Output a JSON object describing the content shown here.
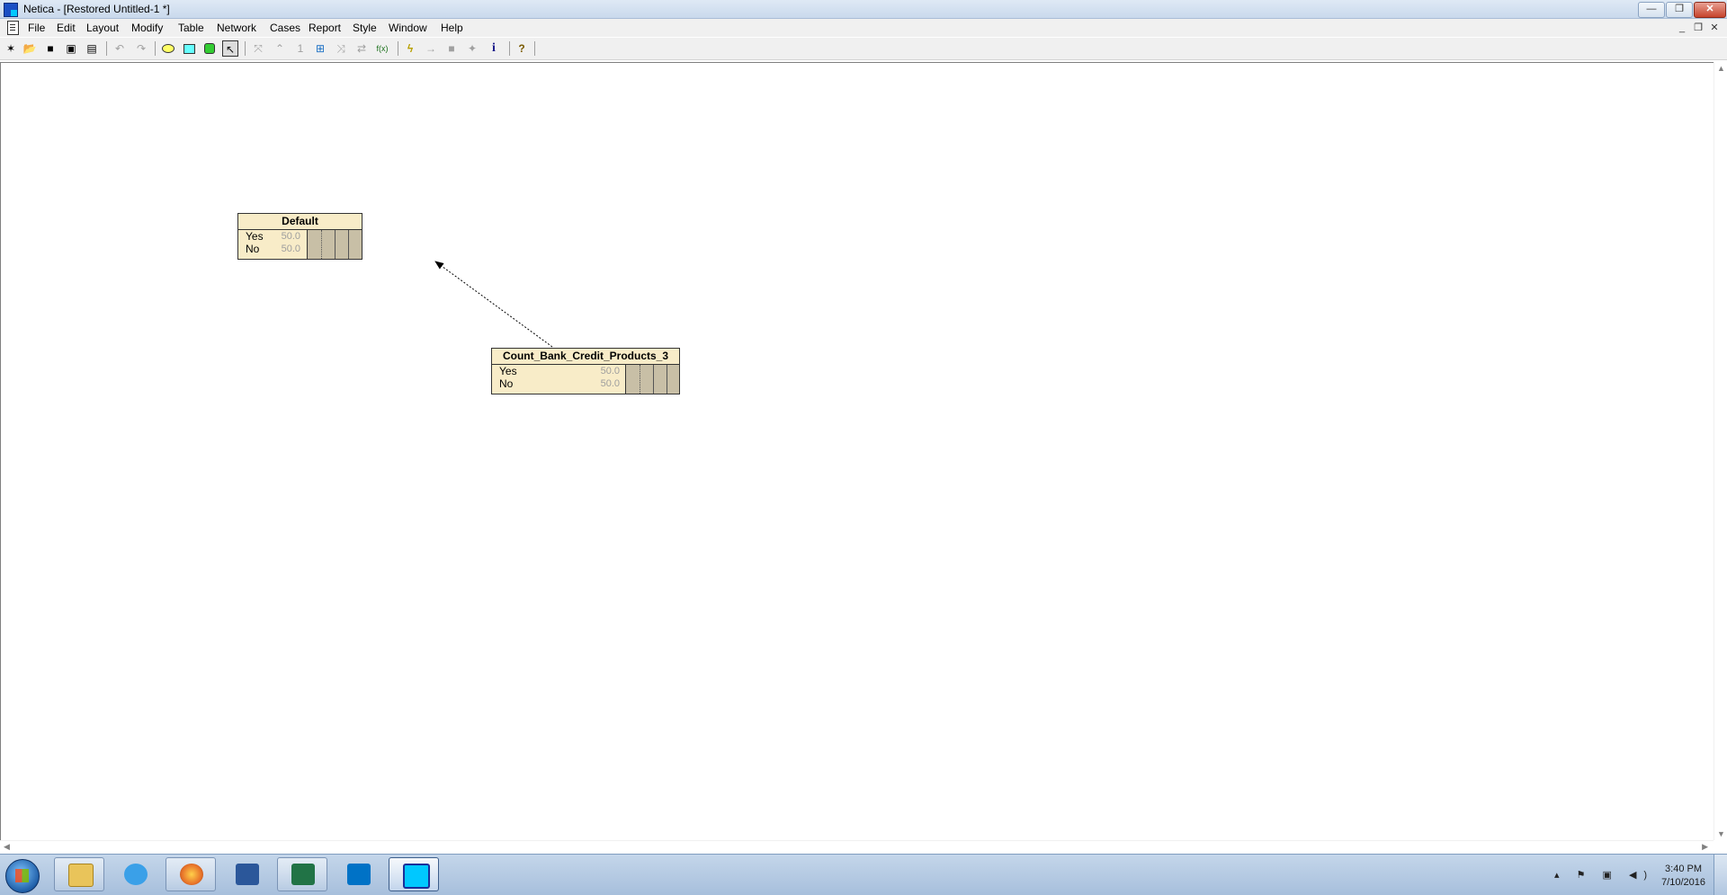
{
  "window": {
    "title": "Netica - [Restored Untitled-1 *]",
    "controls": {
      "minimize": "—",
      "maximize": "❐",
      "close": "✕"
    }
  },
  "menubar": {
    "items": [
      "File",
      "Edit",
      "Layout",
      "Modify",
      "Table",
      "Network",
      "Cases",
      "Report",
      "Style",
      "Window",
      "Help"
    ],
    "mdi_controls": {
      "minimize": "_",
      "restore": "❐",
      "close": "✕"
    }
  },
  "toolbar": {
    "buttons": [
      {
        "icon": "new-network-icon",
        "glyph": "✶",
        "enabled": true
      },
      {
        "icon": "open-icon",
        "glyph": "📂",
        "enabled": true
      },
      {
        "icon": "save-icon",
        "glyph": "■",
        "enabled": true
      },
      {
        "icon": "save-as-icon",
        "glyph": "▣",
        "enabled": true
      },
      {
        "icon": "save-all-icon",
        "glyph": "▤",
        "enabled": true
      },
      {
        "icon": "undo-icon",
        "glyph": "↶",
        "enabled": false
      },
      {
        "icon": "redo-icon",
        "glyph": "↷",
        "enabled": false
      },
      {
        "icon": "nature-node-icon",
        "glyph": "",
        "enabled": true
      },
      {
        "icon": "decision-node-icon",
        "glyph": "",
        "enabled": true
      },
      {
        "icon": "utility-node-icon",
        "glyph": "",
        "enabled": true
      },
      {
        "icon": "select-arrow-icon",
        "glyph": "↖",
        "enabled": true
      },
      {
        "icon": "add-link-icon",
        "glyph": "⤧",
        "enabled": false
      },
      {
        "icon": "remove-link-icon",
        "glyph": "⌃",
        "enabled": false
      },
      {
        "icon": "constant-icon",
        "glyph": "1",
        "enabled": false
      },
      {
        "icon": "node-table-icon",
        "glyph": "⊞",
        "enabled": true
      },
      {
        "icon": "absorb-icon",
        "glyph": "⤨",
        "enabled": false
      },
      {
        "icon": "reverse-link-icon",
        "glyph": "⇄",
        "enabled": false
      },
      {
        "icon": "equation-icon",
        "glyph": "f(x)",
        "enabled": true
      },
      {
        "icon": "compile-icon",
        "glyph": "ϟ",
        "enabled": true
      },
      {
        "icon": "most-probable-icon",
        "glyph": "→",
        "enabled": false
      },
      {
        "icon": "retract-icon",
        "glyph": "■",
        "enabled": false
      },
      {
        "icon": "learn-icon",
        "glyph": "✦",
        "enabled": false
      },
      {
        "icon": "info-icon",
        "glyph": "i",
        "enabled": true
      },
      {
        "icon": "help-icon",
        "glyph": "?",
        "enabled": true
      }
    ]
  },
  "nodes": [
    {
      "name": "Default",
      "states": [
        {
          "label": "Yes",
          "value": "50.0",
          "belief": 0.5
        },
        {
          "label": "No",
          "value": "50.0",
          "belief": 0.5
        }
      ]
    },
    {
      "name": "Count_Bank_Credit_Products_3",
      "states": [
        {
          "label": "Yes",
          "value": "50.0",
          "belief": 0.5
        },
        {
          "label": "No",
          "value": "50.0",
          "belief": 0.5
        }
      ]
    }
  ],
  "links": [
    {
      "from": "Count_Bank_Credit_Products_3",
      "to": "Default",
      "style": "dotted"
    }
  ],
  "taskbar": {
    "apps": [
      {
        "name": "windows-explorer-icon",
        "color": "#e9c45a",
        "active": false
      },
      {
        "name": "internet-explorer-icon",
        "color": "#3aa0e8",
        "active": false
      },
      {
        "name": "firefox-icon",
        "color": "#e8742a",
        "active": false
      },
      {
        "name": "word-icon",
        "color": "#2b579a",
        "active": false
      },
      {
        "name": "excel-icon",
        "color": "#217346",
        "active": false
      },
      {
        "name": "outlook-icon",
        "color": "#0072c6",
        "active": false
      },
      {
        "name": "netica-icon",
        "color": "#00c8ff",
        "active": true
      }
    ],
    "tray_icons": "▴ ⚑ ▣ ◀)",
    "clock": {
      "time": "3:40 PM",
      "date": "7/10/2016"
    }
  }
}
